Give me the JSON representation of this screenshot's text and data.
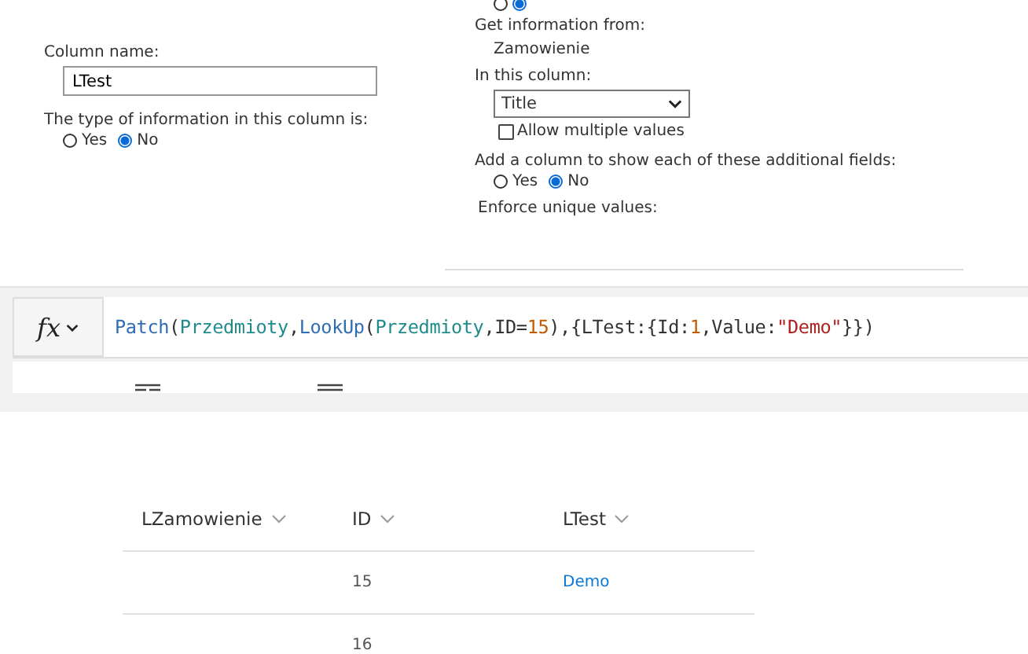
{
  "column_settings": {
    "name_label": "Column name:",
    "name_value": "LTest",
    "type_label": "The type of information in this column is:",
    "type_options": [
      {
        "label": "Yes",
        "selected": false
      },
      {
        "label": "No",
        "selected": true
      }
    ]
  },
  "lookup_settings": {
    "top_options": [
      {
        "selected": false
      },
      {
        "selected": true
      }
    ],
    "source_label": "Get information from:",
    "source_value": "Zamowienie",
    "column_label": "In this column:",
    "column_value": "Title",
    "allow_multiple": {
      "label": "Allow multiple values",
      "checked": false
    },
    "additional_label": "Add a column to show each of these additional fields:",
    "additional_options": [
      {
        "label": "Yes",
        "selected": false
      },
      {
        "label": "No",
        "selected": true
      }
    ],
    "unique_label": "Enforce unique values:"
  },
  "formula_bar": {
    "fx": "fx",
    "tokens": [
      {
        "text": "Patch",
        "kind": "function"
      },
      {
        "text": "(",
        "kind": "plain"
      },
      {
        "text": "Przedmioty",
        "kind": "table"
      },
      {
        "text": ",",
        "kind": "plain"
      },
      {
        "text": "LookUp",
        "kind": "function"
      },
      {
        "text": "(",
        "kind": "plain"
      },
      {
        "text": "Przedmioty",
        "kind": "table"
      },
      {
        "text": ",ID=",
        "kind": "plain"
      },
      {
        "text": "15",
        "kind": "number"
      },
      {
        "text": "),{LTest:{Id:",
        "kind": "plain"
      },
      {
        "text": "1",
        "kind": "number"
      },
      {
        "text": ",Value:",
        "kind": "plain"
      },
      {
        "text": "\"Demo\"",
        "kind": "string"
      },
      {
        "text": "}})",
        "kind": "plain"
      }
    ]
  },
  "table": {
    "columns": [
      "LZamowienie",
      "ID",
      "LTest"
    ],
    "rows": [
      [
        "",
        "15",
        "Demo"
      ],
      [
        "",
        "16",
        ""
      ]
    ]
  }
}
